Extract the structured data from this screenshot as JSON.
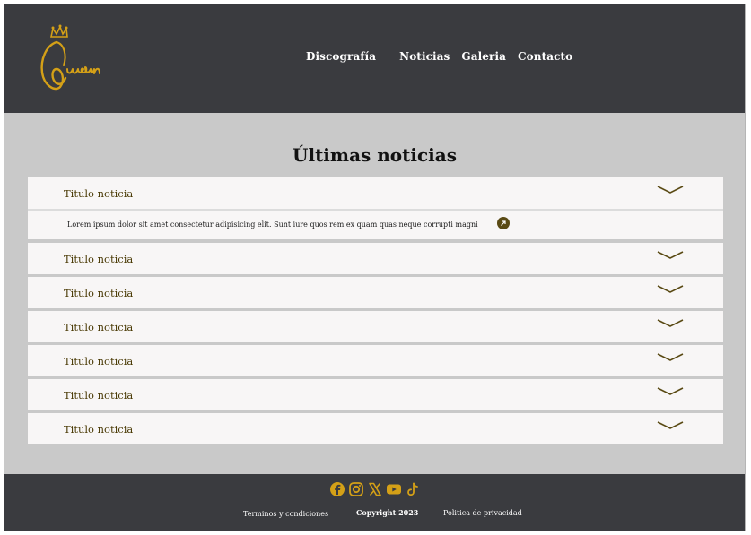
{
  "header": {
    "logo_text": "Queen",
    "nav": [
      "Discografía",
      "Noticias",
      "Galeria",
      "Contacto"
    ]
  },
  "main": {
    "title": "Últimas noticias",
    "items": [
      {
        "title": "Titulo noticia",
        "expanded": true,
        "body": "Lorem ipsum dolor sit amet consectetur adipisicing elit. Sunt iure quos rem ex quam quas neque corrupti magni"
      },
      {
        "title": "Titulo noticia",
        "expanded": false
      },
      {
        "title": "Titulo noticia",
        "expanded": false
      },
      {
        "title": "Titulo noticia",
        "expanded": false
      },
      {
        "title": "Titulo noticia",
        "expanded": false
      },
      {
        "title": "Titulo noticia",
        "expanded": false
      },
      {
        "title": "Titulo noticia",
        "expanded": false
      }
    ]
  },
  "footer": {
    "social_icons": [
      "facebook-icon",
      "instagram-icon",
      "x-icon",
      "youtube-icon",
      "tiktok-icon"
    ],
    "links": [
      "Terminos y condiciones",
      "Copyright 2023",
      "Politica de privacidad"
    ]
  },
  "colors": {
    "header_bg": "#3a3b3f",
    "page_bg": "#c9c9c9",
    "card_bg": "#f8f6f6",
    "accent_gold": "#d4a017",
    "chevron": "#5a4a14"
  }
}
